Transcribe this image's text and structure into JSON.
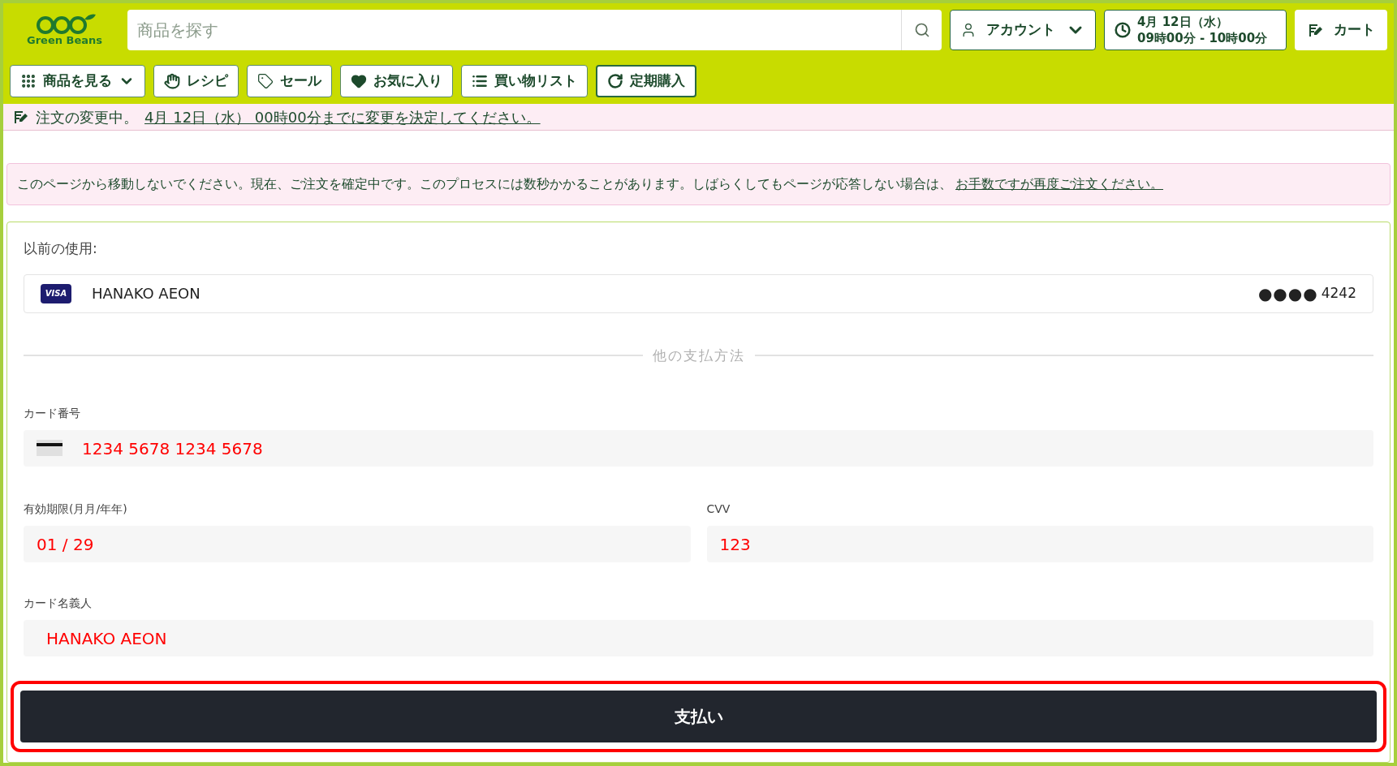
{
  "header": {
    "logo_text": "Green Beans",
    "search": {
      "placeholder": "商品を探す"
    },
    "account_button": "アカウント",
    "delivery_slot": {
      "date": "4月 12日（水）",
      "time": "09時00分 - 10時00分"
    },
    "cart_button": "カート"
  },
  "nav": [
    {
      "label": "商品を見る",
      "kind": "grid",
      "dropdown": true,
      "outlined": false
    },
    {
      "label": "レシピ",
      "kind": "recipe",
      "dropdown": false,
      "outlined": false
    },
    {
      "label": "セール",
      "kind": "tag",
      "dropdown": false,
      "outlined": false
    },
    {
      "label": "お気に入り",
      "kind": "heart",
      "dropdown": false,
      "outlined": false
    },
    {
      "label": "買い物リスト",
      "kind": "list",
      "dropdown": false,
      "outlined": false
    },
    {
      "label": "定期購入",
      "kind": "refresh",
      "dropdown": false,
      "outlined": true
    }
  ],
  "order_notice": {
    "text": "注文の変更中。",
    "link": "4月 12日（水） 00時00分までに変更を決定してください。"
  },
  "warning": {
    "text": "このページから移動しないでください。現在、ご注文を確定中です。このプロセスには数秒かかることがあります。しばらくしてもページが応答しない場合は、",
    "link": "お手数ですが再度ご注文ください。"
  },
  "payment": {
    "previous_label": "以前の使用:",
    "saved_card": {
      "brand": "VISA",
      "name": "HANAKO AEON",
      "masked": "●●●●",
      "last4": "4242"
    },
    "divider_label": "他の支払方法",
    "card_number": {
      "label": "カード番号",
      "value": "1234 5678 1234 5678"
    },
    "expiry": {
      "label": "有効期限(月月/年年)",
      "value": "01 / 29"
    },
    "cvv": {
      "label": "CVV",
      "value": "123"
    },
    "holder": {
      "label": "カード名義人",
      "value": "HANAKO AEON"
    },
    "pay_button": "支払い"
  }
}
